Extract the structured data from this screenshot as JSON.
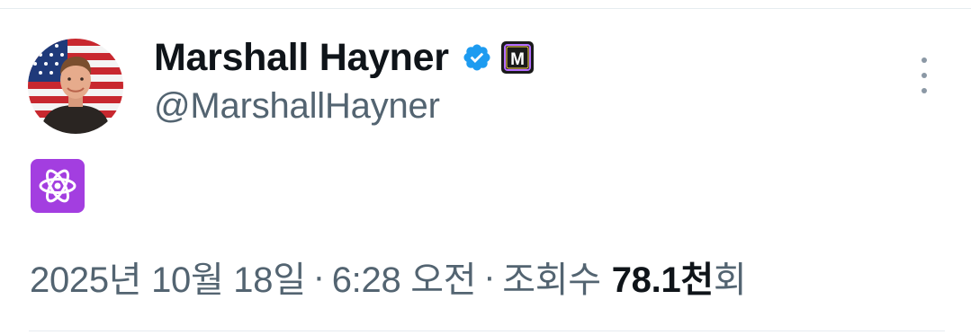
{
  "author": {
    "display_name": "Marshall Hayner",
    "handle": "@MarshallHayner",
    "verified": true,
    "affiliate_badge_letter": "M"
  },
  "post": {
    "emoji_icon": "atom-symbol-icon"
  },
  "meta": {
    "date": "2025년 10월 18일",
    "separator": "·",
    "time": "6:28 오전",
    "views_label": "조회수",
    "views_count": "78.1천",
    "views_suffix": "회"
  },
  "colors": {
    "primary_text": "#0f1419",
    "secondary_text": "#536471",
    "verified_blue": "#1d9bf0",
    "emoji_purple": "#a33ee0",
    "divider": "#e6ecf0"
  }
}
